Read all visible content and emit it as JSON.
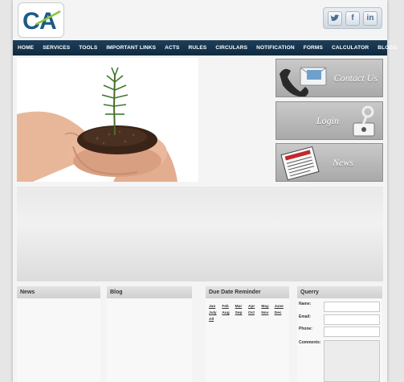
{
  "logo": {
    "text": "CA"
  },
  "social": {
    "twitter": "t",
    "facebook": "f",
    "linkedin": "in"
  },
  "nav": [
    "HOME",
    "SERVICES",
    "TOOLS",
    "IMPORTANT LINKS",
    "ACTS",
    "RULES",
    "CIRCULARS",
    "NOTIFICATION",
    "FORMS",
    "CALCULATOR",
    "BLOGS"
  ],
  "side": {
    "contact": "Contact Us",
    "login": "Login",
    "news": "News"
  },
  "columns": {
    "news": "News",
    "blog": "Blog",
    "due": "Due Date Reminder",
    "querry": "Querry"
  },
  "months": [
    "Jan",
    "Feb",
    "Mar",
    "Apr",
    "May",
    "June",
    "July",
    "Aug",
    "Sep",
    "Oct",
    "Nov",
    "Dec",
    "All"
  ],
  "form": {
    "name": "Name:",
    "email": "Email:",
    "phone": "Phone:",
    "comments": "Comments:"
  },
  "colors": {
    "nav": "#1d3f5b",
    "accent_green": "#8cc63f",
    "logo_blue": "#1c5a87"
  }
}
